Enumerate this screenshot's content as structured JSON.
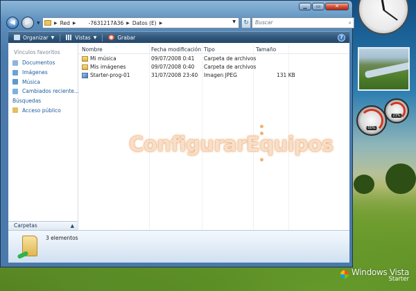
{
  "window": {
    "caption_buttons": {
      "minimize": "▁",
      "maximize": "▭",
      "close": "✕"
    }
  },
  "address_bar": {
    "segments": [
      "Red",
      "-7631217A36",
      "Datos (E)"
    ],
    "search_placeholder": "Buscar"
  },
  "toolbar": {
    "organize": "Organizar",
    "views": "Vistas",
    "burn": "Grabar"
  },
  "sidebar": {
    "title": "Vínculos favoritos",
    "items": [
      {
        "label": "Documentos",
        "icon": "documents-icon"
      },
      {
        "label": "Imágenes",
        "icon": "pictures-icon"
      },
      {
        "label": "Música",
        "icon": "music-icon"
      },
      {
        "label": "Cambiados reciente...",
        "icon": "recent-icon"
      },
      {
        "label": "Búsquedas",
        "icon": "searches-icon"
      },
      {
        "label": "Acceso público",
        "icon": "public-folder-icon"
      }
    ],
    "footer": "Carpetas"
  },
  "columns": {
    "name": "Nombre",
    "modified": "Fecha modificación",
    "type": "Tipo",
    "size": "Tamaño"
  },
  "files": [
    {
      "name": "Mi música",
      "modified": "09/07/2008 0:41",
      "type": "Carpeta de archivos",
      "size": "",
      "icon": "folder-icon"
    },
    {
      "name": "Mis imágenes",
      "modified": "09/07/2008 0:40",
      "type": "Carpeta de archivos",
      "size": "",
      "icon": "folder-icon"
    },
    {
      "name": "Starter-prog-01",
      "modified": "31/07/2008 23:40",
      "type": "Imagen JPEG",
      "size": "131 KB",
      "icon": "image-file-icon"
    }
  ],
  "details": {
    "count": "3 elementos"
  },
  "watermark": "ConfigurarEquipos",
  "branding": {
    "product": "Windows Vista",
    "edition": "Starter"
  },
  "colors": {
    "link_blue": "#1c5a9d",
    "toolbar_blue": "#2e5478",
    "close_red": "#d6523a"
  }
}
